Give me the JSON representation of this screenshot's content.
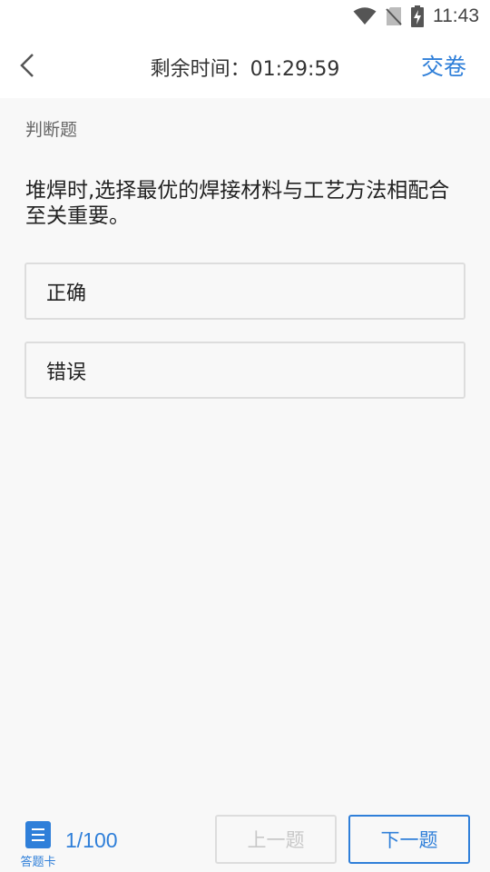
{
  "status": {
    "time": "11:43"
  },
  "header": {
    "timer_label": "剩余时间：01:29:59",
    "submit_label": "交卷"
  },
  "question": {
    "type": "判断题",
    "text": "堆焊时,选择最优的焊接材料与工艺方法相配合至关重要。",
    "options": [
      "正确",
      "错误"
    ]
  },
  "footer": {
    "answer_card_label": "答题卡",
    "progress": "1/100",
    "prev_label": "上一题",
    "next_label": "下一题"
  },
  "colors": {
    "accent": "#2f7fd9",
    "disabled": "#c8c8c8",
    "border": "#dddddd"
  },
  "icons": [
    "wifi-icon",
    "no-sim-icon",
    "battery-charging-icon",
    "back-arrow-icon",
    "answer-card-icon"
  ]
}
